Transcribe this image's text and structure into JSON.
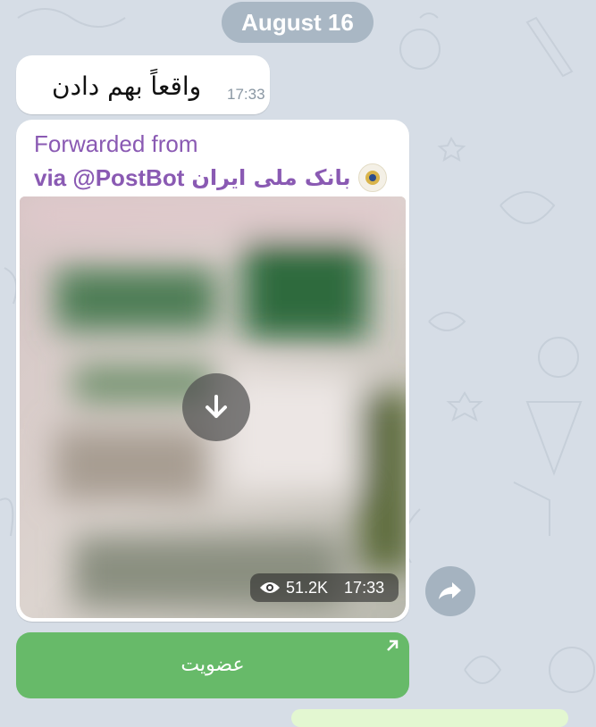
{
  "date_separator": "August 16",
  "messages": [
    {
      "text": "واقعاً بهم دادن",
      "time": "17:33"
    },
    {
      "forwarded_label": "Forwarded from",
      "forwarded_channel": "بانک ملی ایران",
      "forwarded_via": "via @PostBot",
      "media": {
        "views": "51.2K",
        "time": "17:33"
      },
      "button_label": "عضویت"
    }
  ],
  "colors": {
    "background": "#d6dde6",
    "accent_purple": "#8a5ab3",
    "join_button": "#67ba69"
  },
  "icons": [
    "download-icon",
    "eye-icon",
    "share-icon",
    "external-link-arrow-icon",
    "bank-logo-icon"
  ]
}
